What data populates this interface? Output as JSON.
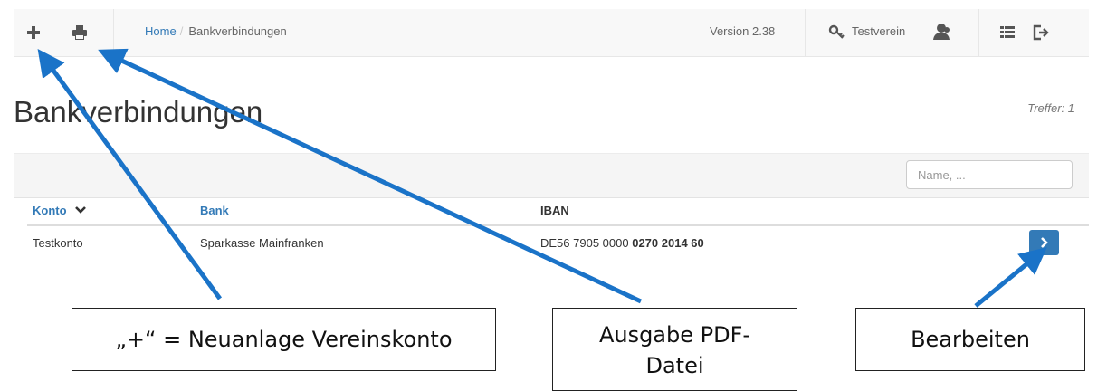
{
  "toolbar": {
    "add_icon": "plus-icon",
    "print_icon": "print-icon",
    "breadcrumb": {
      "home": "Home",
      "separator": "/",
      "current": "Bankverbindungen"
    },
    "version": "Version 2.38",
    "club_name": "Testverein",
    "key_icon": "key-icon",
    "user_icon": "user-icon",
    "list_icon": "list-icon",
    "logout_icon": "logout-icon"
  },
  "page": {
    "title": "Bankverbindungen",
    "hits": "Treffer: 1"
  },
  "search": {
    "placeholder": "Name, ..."
  },
  "table": {
    "columns": [
      {
        "label": "Konto",
        "sortable": true,
        "sorted": "desc"
      },
      {
        "label": "Bank",
        "sortable": true
      },
      {
        "label": "IBAN",
        "sortable": false
      }
    ],
    "rows": [
      {
        "konto": "Testkonto",
        "bank": "Sparkasse Mainfranken",
        "iban_prefix": "DE56 7905 0000",
        "iban_suffix": "0270 2014 60"
      }
    ],
    "row_action_icon": "chevron-right-icon"
  },
  "annotations": [
    {
      "text": "„+“ = Neuanlage Vereinskonto"
    },
    {
      "text": "Ausgabe PDF-Datei"
    },
    {
      "text": "Bearbeiten"
    }
  ],
  "colors": {
    "accent": "#337ab7",
    "arrow": "#1a73c8",
    "toolbar_bg": "#f8f8f8"
  }
}
